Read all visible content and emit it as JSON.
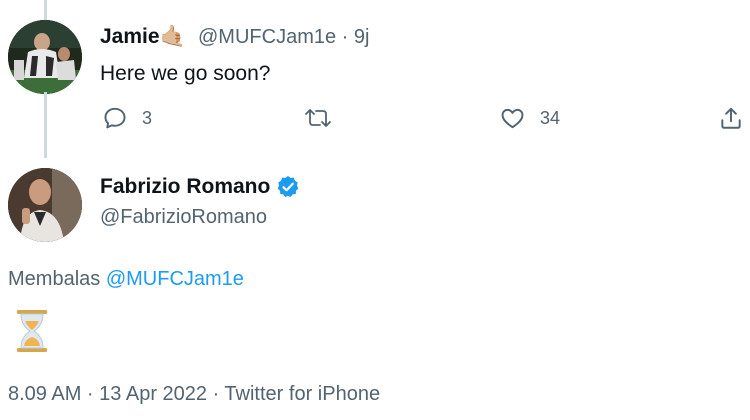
{
  "reply_tweet": {
    "name": "Jamie",
    "name_emoji": "🤙🏼",
    "handle": "@MUFCJam1e",
    "separator": "·",
    "time": "9j",
    "text": "Here we go soon?",
    "actions": {
      "reply_count": "3",
      "retweet_count": "",
      "like_count": "34"
    }
  },
  "main_tweet": {
    "name": "Fabrizio Romano",
    "verified": true,
    "handle": "@FabrizioRomano",
    "reply_prefix": "Membalas",
    "reply_to": "@MUFCJam1e",
    "emoji": "⏳",
    "meta": "8.09 AM · 13 Apr 2022 · Twitter for iPhone"
  },
  "colors": {
    "accent": "#1d9bf0",
    "text": "#0f1419",
    "muted": "#536471"
  },
  "icons": [
    "reply-icon",
    "retweet-icon",
    "like-icon",
    "share-icon",
    "verified-badge-icon",
    "hourglass-icon"
  ]
}
